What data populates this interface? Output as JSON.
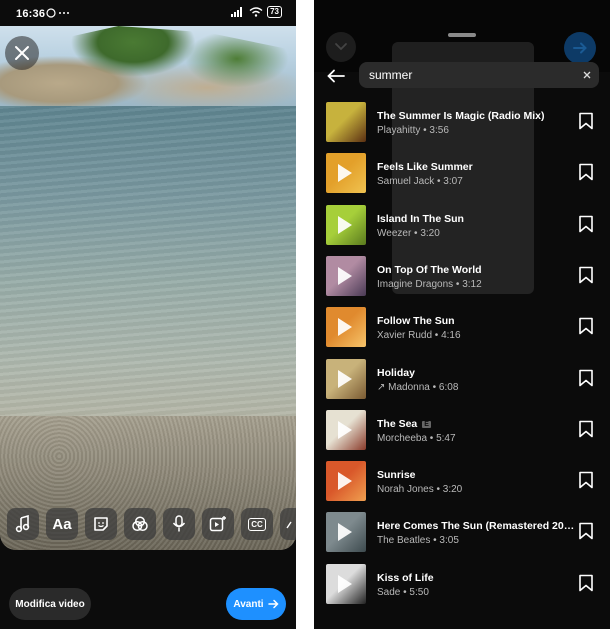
{
  "status_bar": {
    "time": "16:36",
    "battery": "73"
  },
  "editor": {
    "edit_video_label": "Modifica video",
    "next_label": "Avanti",
    "tools": [
      {
        "name": "music-icon"
      },
      {
        "name": "text-tool",
        "label": "Aa"
      },
      {
        "name": "sticker-icon"
      },
      {
        "name": "effects-icon"
      },
      {
        "name": "microphone-icon"
      },
      {
        "name": "add-clip-icon"
      },
      {
        "name": "captions-icon",
        "label": "CC"
      }
    ]
  },
  "music_search": {
    "query": "summer",
    "tracks": [
      {
        "title": "The Summer Is Magic (Radio Mix)",
        "subtitle": "Playahitty • 3:56",
        "cover": [
          "#c7b23d",
          "#5b2f12"
        ]
      },
      {
        "title": "Feels Like Summer",
        "subtitle": "Samuel Jack • 3:07",
        "cover": [
          "#e3a02a",
          "#f0c351"
        ]
      },
      {
        "title": "Island In The Sun",
        "subtitle": "Weezer • 3:20",
        "cover": [
          "#a6cf3a",
          "#5a7a1e"
        ]
      },
      {
        "title": "On Top Of The World",
        "subtitle": "Imagine Dragons • 3:12",
        "cover": [
          "#b18ba2",
          "#4a3a55"
        ]
      },
      {
        "title": "Follow The Sun",
        "subtitle": "Xavier Rudd • 4:16",
        "cover": [
          "#e08a2e",
          "#f6c46b"
        ]
      },
      {
        "title": "Holiday",
        "subtitle": "↗ Madonna • 6:08",
        "cover": [
          "#c8b27a",
          "#7a5a32"
        ]
      },
      {
        "title": "The Sea",
        "explicit": "E",
        "subtitle": "Morcheeba • 5:47",
        "cover": [
          "#e6e1d2",
          "#8a3a2a"
        ]
      },
      {
        "title": "Sunrise",
        "subtitle": "Norah Jones • 3:20",
        "cover": [
          "#d9582a",
          "#f0a050"
        ]
      },
      {
        "title": "Here Comes The Sun (Remastered 20…",
        "subtitle": "The Beatles • 3:05",
        "cover": [
          "#7e8a8e",
          "#3d4a4e"
        ]
      },
      {
        "title": "Kiss of Life",
        "subtitle": "Sade • 5:50",
        "cover": [
          "#dcdcdc",
          "#222222"
        ]
      }
    ]
  }
}
